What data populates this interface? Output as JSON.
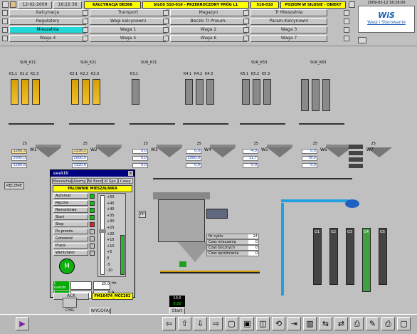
{
  "header": {
    "date": "12-02-2009",
    "time": "16:22:36",
    "alarm1": "KALCYNACJA DB368",
    "alarm2": "SILOS 510-010 - PRZEKROCZONY PRÓG L1",
    "alarm3": "510-010",
    "alarm4": "POZIOM W SILOSIE - OBIEKT",
    "datetime2": "2009-02-12 16:26:00"
  },
  "nav": {
    "row1": [
      "Kalcynacja",
      "Transport",
      "Magazyn",
      "Tr Mieszalnia"
    ],
    "row2": [
      "Regulatory",
      "Wagi kalcynowni",
      "Beczki Tr Pneum.",
      "Param.Kalcynowni"
    ],
    "row3": [
      "Mieszalnia",
      "Waga 1",
      "Waga 2",
      "Waga 3"
    ],
    "row4": [
      "Waga 4",
      "Waga 5",
      "Waga 6",
      "Waga 7"
    ]
  },
  "logo": {
    "line1": "WiS",
    "line2": "Wagi i Sterowanie"
  },
  "silo_groups": [
    "SUR_K11",
    "SUR_K21",
    "SUR_K31",
    "SUR_K53",
    "SUR_K63"
  ],
  "silo_labels": {
    "g1": [
      "K1.1",
      "K1.2",
      "K1.3"
    ],
    "g2": [
      "K2.1",
      "K2.2",
      "K2.3"
    ],
    "g3": [
      "K3.1"
    ],
    "g4": [
      "K4.1",
      "K4.2",
      "K4.3"
    ],
    "g5": [
      "K5.1",
      "K5.2",
      "K5.3"
    ]
  },
  "scales": {
    "w1": {
      "label": "W1",
      "setpoint": "25",
      "vals": [
        "1280,3",
        "2000,0",
        "1280,6"
      ]
    },
    "w2": {
      "label": "W2",
      "setpoint": "25",
      "vals": [
        "1336,2",
        "2000,0",
        "1320,6"
      ]
    },
    "w3": {
      "label": "W3",
      "setpoint": "25",
      "vals": [
        "0,0",
        "0,0",
        "0,0"
      ]
    },
    "w4": {
      "label": "W4",
      "setpoint": "25",
      "vals": [
        "0,0",
        "2000,0",
        "0,0"
      ]
    },
    "w5": {
      "label": "W5",
      "setpoint": "25",
      "vals": [
        "-4,0",
        "11,7",
        "0,0"
      ]
    },
    "w6": {
      "label": "W6",
      "setpoint": "25",
      "vals": [
        "0,0",
        "78,0",
        "0,0"
      ]
    },
    "w7": {
      "label": "W7",
      "setpoint": "25"
    }
  },
  "reczne": "RĘCZNIE",
  "dialog": {
    "title": "eeekkk",
    "tabs": [
      "Mieszalnia",
      "Alarmy",
      "Sil Bocz",
      "Kl Spn",
      "Czasy"
    ],
    "header": "FALOWNIK MIESZALNIKA",
    "states": [
      "Automat",
      "Ręczne",
      "Remontowe",
      "Start",
      "Stop",
      "Po przodu",
      "Gotowość",
      "Praca",
      "Wentylator"
    ],
    "motor": "M",
    "scale": [
      "+50",
      "+45",
      "+40",
      "+35",
      "+30",
      "+25",
      "+20",
      "+15",
      "+10",
      "+5",
      "0",
      "-5",
      "-10"
    ],
    "L_goden": "L Godzin",
    "L_poznum": "L Poznum",
    "freq": "25,0",
    "hz": "Hz",
    "amps": "4",
    "a": "A",
    "ack": "ACK",
    "device": "FM16474_MCC202"
  },
  "mixer_info": [
    {
      "label": "Nr cyklu",
      "value": "24"
    },
    {
      "label": "Czas mieszania",
      "value": "0"
    },
    {
      "label": "Czas bocznych",
      "value": "0"
    },
    {
      "label": "Czas opróżniania",
      "value": "0"
    }
  ],
  "mixer": {
    "pp": "PP",
    "counter": "10,0",
    "counter2": "0,00",
    "start": "Start"
  },
  "bottom": {
    "cyk": "CYKL",
    "wycofaj": "WYCOFAJ"
  },
  "bunkers": [
    "G1",
    "G2",
    "G3",
    "G4",
    "G5"
  ],
  "colors": {
    "navSelected": "#20d8d8",
    "alarm": "#ffff00",
    "dialogTitle": "#000080"
  }
}
